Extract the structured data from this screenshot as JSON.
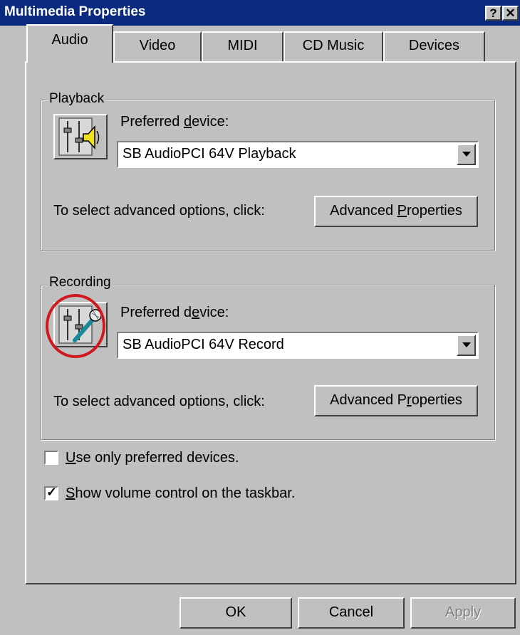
{
  "window": {
    "title": "Multimedia Properties",
    "help_button": "?",
    "close_button": "✕"
  },
  "tabs": [
    {
      "label": "Audio",
      "active": true
    },
    {
      "label": "Video",
      "active": false
    },
    {
      "label": "MIDI",
      "active": false
    },
    {
      "label": "CD Music",
      "active": false
    },
    {
      "label": "Devices",
      "active": false
    }
  ],
  "playback": {
    "group_label": "Playback",
    "preferred_pre": "Preferred ",
    "preferred_u": "d",
    "preferred_post": "evice:",
    "device": "SB AudioPCI 64V Playback",
    "advanced_text": "To select advanced options, click:",
    "advanced_button_pre": "Advanced ",
    "advanced_button_u": "P",
    "advanced_button_post": "roperties",
    "icon": "speaker-mixer-icon"
  },
  "recording": {
    "group_label": "Recording",
    "preferred_pre": "Preferred d",
    "preferred_u": "e",
    "preferred_post": "vice:",
    "device": "SB AudioPCI 64V Record",
    "advanced_text": "To select advanced options, click:",
    "advanced_button_pre": "Advanced P",
    "advanced_button_u": "r",
    "advanced_button_post": "operties",
    "icon": "microphone-mixer-icon"
  },
  "options": {
    "use_preferred_u": "U",
    "use_preferred_rest": "se only preferred devices.",
    "use_preferred_checked": false,
    "show_volume_u": "S",
    "show_volume_rest": "how volume control on the taskbar.",
    "show_volume_checked": true
  },
  "footer": {
    "ok": "OK",
    "cancel": "Cancel",
    "apply": "Apply"
  },
  "colors": {
    "title_bar": "#0a2a80",
    "face": "#c0c0c0",
    "annotation_circle": "#d0191e"
  }
}
